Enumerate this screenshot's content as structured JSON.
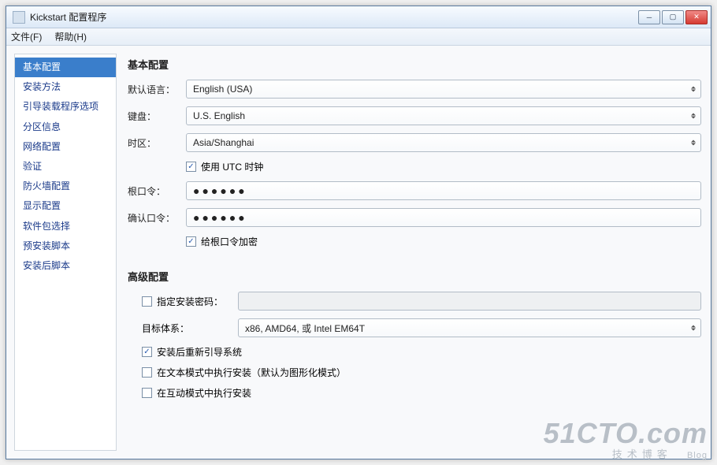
{
  "window": {
    "title": "Kickstart 配置程序"
  },
  "menubar": {
    "file": "文件(F)",
    "help": "帮助(H)"
  },
  "sidebar": {
    "items": [
      "基本配置",
      "安装方法",
      "引导装载程序选项",
      "分区信息",
      "网络配置",
      "验证",
      "防火墙配置",
      "显示配置",
      "软件包选择",
      "预安装脚本",
      "安装后脚本"
    ],
    "active_index": 0
  },
  "basic": {
    "section_title": "基本配置",
    "lang_label": "默认语言：",
    "lang_value": "English (USA)",
    "keyboard_label": "键盘：",
    "keyboard_value": "U.S. English",
    "timezone_label": "时区：",
    "timezone_value": "Asia/Shanghai",
    "utc_label": "使用 UTC 时钟",
    "utc_checked": true,
    "rootpw_label": "根口令：",
    "rootpw_display": "●●●●●●",
    "confirm_label": "确认口令：",
    "confirm_display": "●●●●●●",
    "encrypt_label": "给根口令加密",
    "encrypt_checked": true
  },
  "advanced": {
    "section_title": "高级配置",
    "installpw_label": "指定安装密码：",
    "installpw_checked": false,
    "installpw_value": "",
    "arch_label": "目标体系：",
    "arch_value": "x86, AMD64, 或 Intel EM64T",
    "reboot_label": "安装后重新引导系统",
    "reboot_checked": true,
    "textmode_label": "在文本模式中执行安装（默认为图形化模式）",
    "textmode_checked": false,
    "interactive_label": "在互动模式中执行安装",
    "interactive_checked": false
  },
  "watermark": {
    "big": "51CTO.com",
    "small": "技术博客",
    "tiny": "Blog"
  }
}
